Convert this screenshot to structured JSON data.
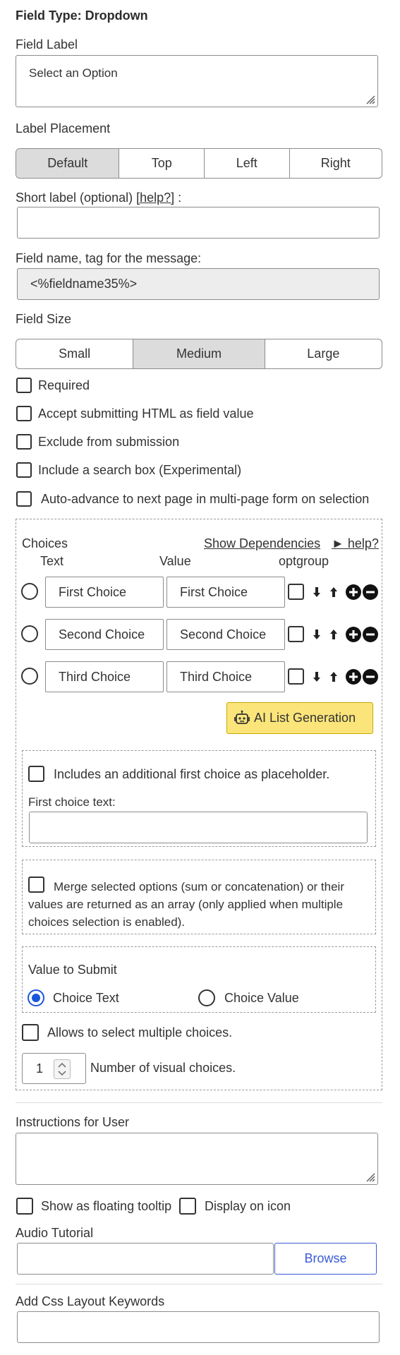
{
  "header": {
    "title": "Field Type: Dropdown"
  },
  "field_label": {
    "label": "Field Label",
    "value": "Select an Option"
  },
  "label_placement": {
    "label": "Label Placement",
    "options": [
      "Default",
      "Top",
      "Left",
      "Right"
    ],
    "selected": "Default"
  },
  "short_label": {
    "label_prefix": "Short label (optional) ",
    "help": "[help?]",
    "label_suffix": " :",
    "value": ""
  },
  "field_name": {
    "label": "Field name, tag for the message:",
    "value": "<%fieldname35%>"
  },
  "field_size": {
    "label": "Field Size",
    "options": [
      "Small",
      "Medium",
      "Large"
    ],
    "selected": "Medium"
  },
  "options": {
    "required": "Required",
    "accept_html": "Accept submitting HTML as field value",
    "exclude": "Exclude from submission",
    "search_box": "Include a search box (Experimental)",
    "auto_advance": "Auto-advance to next page in multi-page form on selection"
  },
  "choices": {
    "title": "Choices",
    "show_dependencies": "Show Dependencies",
    "help": "► help?",
    "col_text": "Text",
    "col_value": "Value",
    "col_optgroup": "optgroup",
    "rows": [
      {
        "text": "First Choice",
        "value": "First Choice"
      },
      {
        "text": "Second Choice",
        "value": "Second Choice"
      },
      {
        "text": "Third Choice",
        "value": "Third Choice"
      }
    ],
    "ai_button": "AI List Generation"
  },
  "placeholder": {
    "checkbox": "Includes an additional first choice as placeholder.",
    "text_label": "First choice text:",
    "value": ""
  },
  "merge": {
    "checkbox": "Merge selected options (sum or concatenation) or their values are returned as an array (only applied when multiple choices selection is enabled)."
  },
  "value_to_submit": {
    "label": "Value to Submit",
    "options": [
      "Choice Text",
      "Choice Value"
    ],
    "selected": "Choice Text"
  },
  "multiple": {
    "checkbox": "Allows to select multiple choices."
  },
  "visual_choices": {
    "value": "1",
    "label": "Number of visual choices."
  },
  "instructions": {
    "label": "Instructions for User",
    "value": ""
  },
  "tooltip": {
    "floating": "Show as floating tooltip",
    "icon": "Display on icon"
  },
  "audio": {
    "label": "Audio Tutorial",
    "browse": "Browse",
    "value": ""
  },
  "css": {
    "label": "Add Css Layout Keywords",
    "value": ""
  },
  "colors": {
    "accent": "#1a56db",
    "ai_button": "#fbe57a",
    "selected_segment": "#dcdcdc"
  }
}
